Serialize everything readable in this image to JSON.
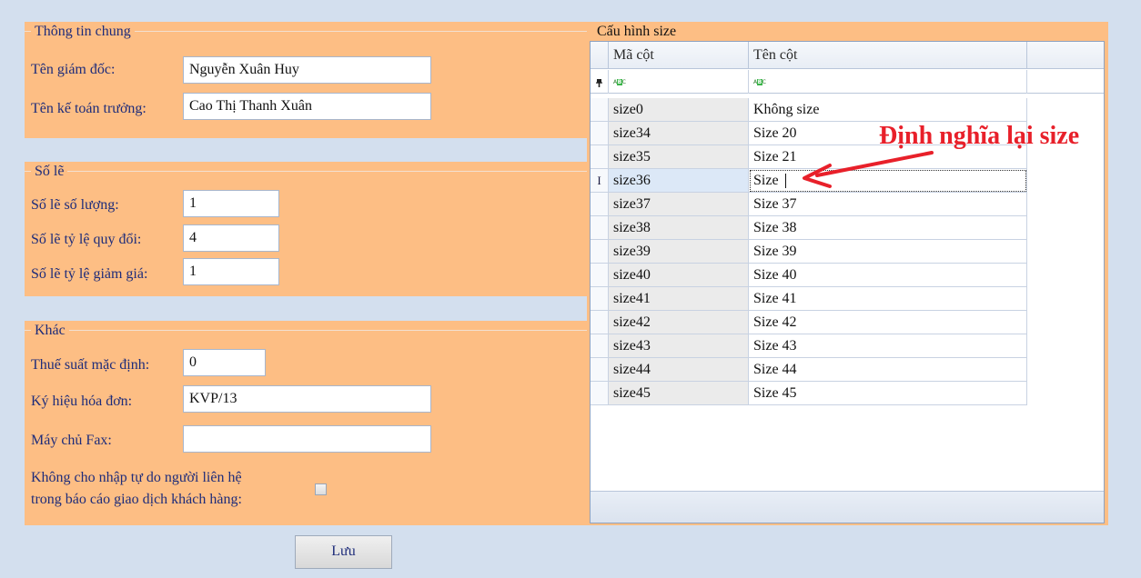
{
  "general": {
    "title": "Thông tin chung",
    "director_label": "Tên giám đốc:",
    "director_value": "Nguyễn Xuân Huy",
    "accountant_label": "Tên kế toán trưởng:",
    "accountant_value": "Cao Thị Thanh Xuân"
  },
  "decimals": {
    "title": "Số lẽ",
    "qty_label": "Số lẽ số lượng:",
    "qty_value": "1",
    "rate_label": "Số lẽ tỷ lệ quy đổi:",
    "rate_value": "4",
    "discount_label": "Số lẽ tỷ lệ giảm giá:",
    "discount_value": "1"
  },
  "other": {
    "title": "Khác",
    "tax_label": "Thuế suất mặc định:",
    "tax_value": "0",
    "invoice_label": "Ký hiệu hóa đơn:",
    "invoice_value": "KVP/13",
    "fax_label": "Máy chủ Fax:",
    "fax_value": "",
    "nofree_line1": "Không cho nhập tự do người liên hệ",
    "nofree_line2": "trong báo cáo giao dịch khách hàng:",
    "nofree_checked": false
  },
  "save_label": "Lưu",
  "size_config": {
    "title": "Cấu hình size",
    "col_code": "Mã cột",
    "col_name": "Tên cột",
    "filter_icon": "pin-icon",
    "editing_row_index": 3,
    "editing_marker": "I",
    "rows": [
      {
        "code": "size0",
        "name": "Không size"
      },
      {
        "code": "size34",
        "name": "Size 20"
      },
      {
        "code": "size35",
        "name": "Size 21"
      },
      {
        "code": "size36",
        "name": "Size"
      },
      {
        "code": "size37",
        "name": "Size 37"
      },
      {
        "code": "size38",
        "name": "Size 38"
      },
      {
        "code": "size39",
        "name": "Size 39"
      },
      {
        "code": "size40",
        "name": "Size 40"
      },
      {
        "code": "size41",
        "name": "Size 41"
      },
      {
        "code": "size42",
        "name": "Size 42"
      },
      {
        "code": "size43",
        "name": "Size 43"
      },
      {
        "code": "size44",
        "name": "Size 44"
      },
      {
        "code": "size45",
        "name": "Size 45"
      }
    ]
  },
  "annotation": {
    "text": "Định nghĩa lại size",
    "color": "#e8202a"
  }
}
